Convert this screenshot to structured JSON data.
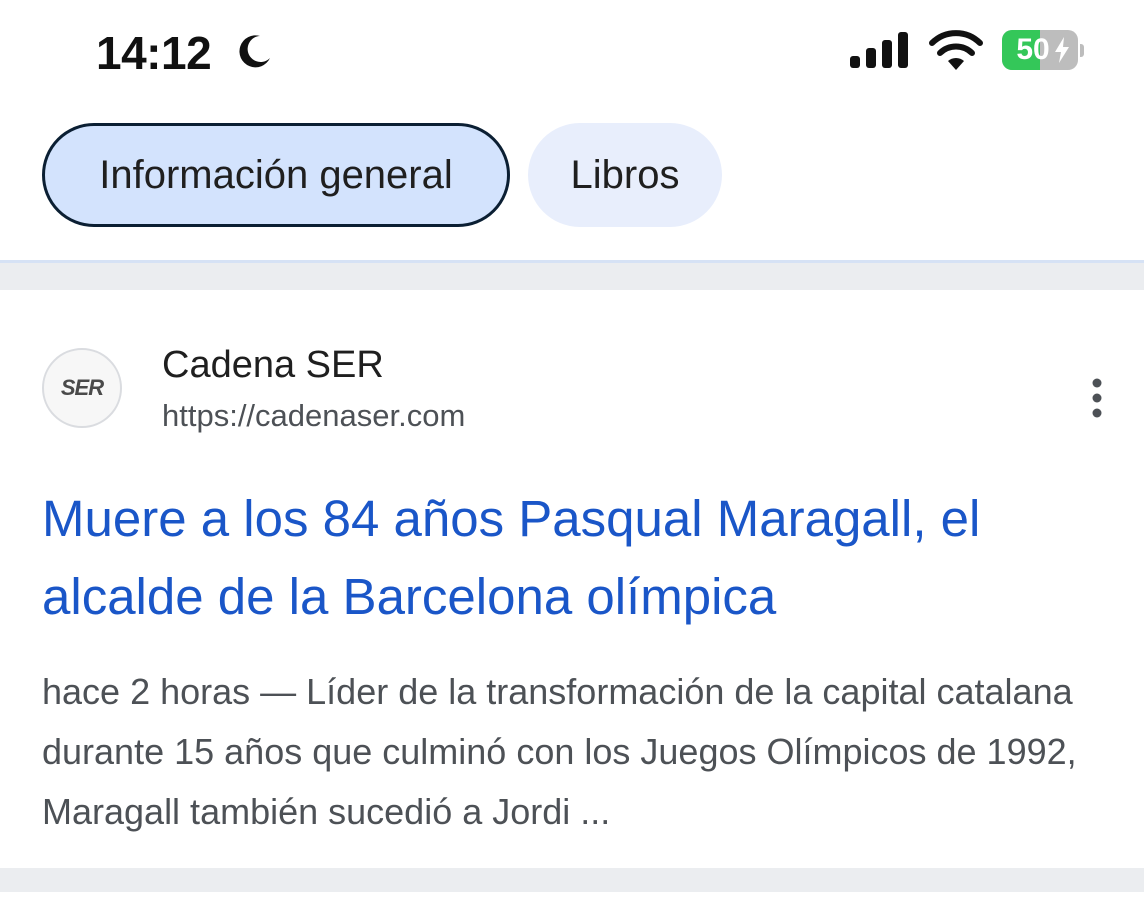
{
  "status_bar": {
    "time": "14:12",
    "moon_icon": "moon-icon",
    "signal_icon": "cellular-signal-icon",
    "wifi_icon": "wifi-icon",
    "battery_level": "50",
    "battery_fraction": 0.5,
    "battery_charging": true,
    "battery_color": "#34c759"
  },
  "chips": [
    {
      "label": "Información general",
      "selected": true
    },
    {
      "label": "Libros",
      "selected": false
    }
  ],
  "result": {
    "favicon_text": "SER",
    "source_name": "Cadena SER",
    "source_url": "https://cadenaser.com",
    "more_icon": "more-vertical-icon",
    "title": "Muere a los 84 años Pasqual Maragall, el alcalde de la Barcelona olímpica",
    "snippet": "hace 2 horas — Líder de la transformación de la capital catalana durante 15 años que culminó con los Juegos Olímpicos de 1992, Maragall también sucedió a Jordi ...",
    "title_color": "#1a56c8"
  }
}
